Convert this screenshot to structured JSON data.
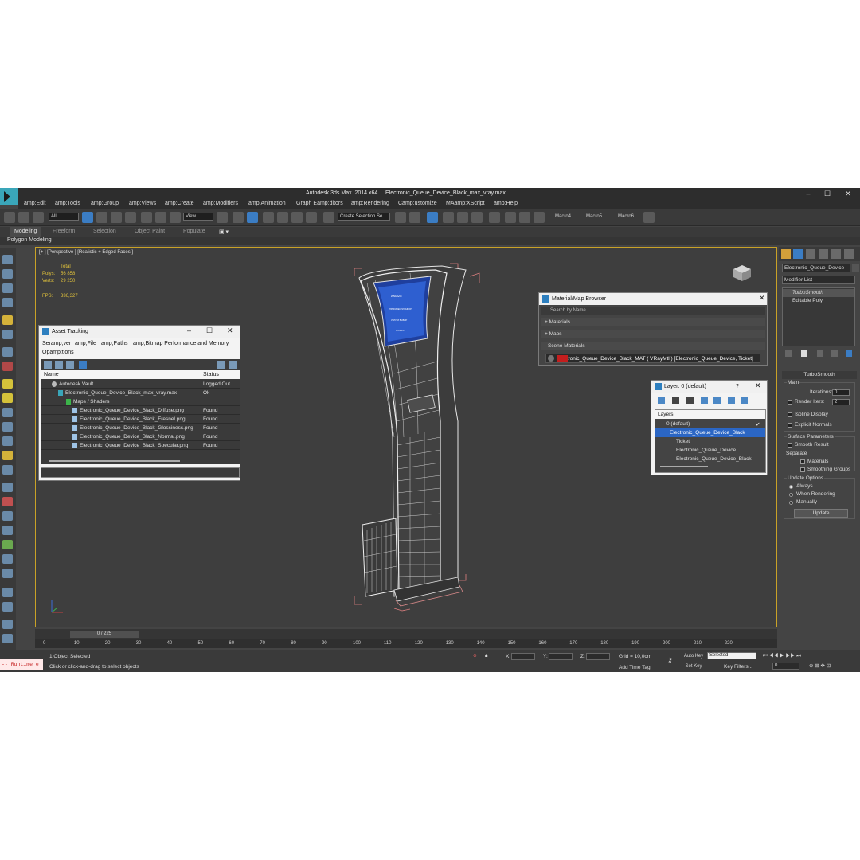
{
  "window": {
    "title": "Autodesk 3ds Max  2014 x64     Electronic_Queue_Device_Black_max_vray.max",
    "min": "–",
    "max": "☐",
    "close": "✕"
  },
  "menu": [
    "amp;Edit",
    "amp;Tools",
    "amp;Group",
    "amp;Views",
    "amp;Create",
    "amp;Modifiers",
    "amp;Animation",
    "Graph Eamp;ditors",
    "amp;Rendering",
    "Camp;ustomize",
    "MAamp;XScript",
    "amp;Help"
  ],
  "toolbar": {
    "filter_select": "All",
    "view_select": "View",
    "selection_set": "Create Selection Se",
    "macros": [
      "Macro4",
      "Macro5",
      "Macro6"
    ]
  },
  "ribbon": {
    "tabs": [
      "Modeling",
      "Freeform",
      "Selection",
      "Object Paint",
      "Populate"
    ],
    "sub": "Polygon Modeling"
  },
  "viewport": {
    "label": "[+ ] [Perspective ] [Realistic + Edged Faces ]",
    "stats": {
      "total_label": "Total",
      "polys_label": "Polys:",
      "polys": "56 858",
      "verts_label": "Verts:",
      "verts": "29 250",
      "fps_label": "FPS:",
      "fps": "336,327"
    },
    "screen": [
      "ANLIZE",
      "ПРОИЗВЕСТИ ВЫБОР",
      "УСЛУГИ ВЫБОР",
      "ОПЛАТА"
    ]
  },
  "asset_tracking": {
    "title": "Asset Tracking",
    "menu": [
      "Seramp;ver",
      "amp;File",
      "amp;Paths",
      "amp;Bitmap Performance and Memory"
    ],
    "menu2": "Opamp;tions",
    "col_name": "Name",
    "col_status": "Status",
    "rows": [
      {
        "name": "Autodesk Vault",
        "status": "Logged Out ..."
      },
      {
        "name": "Electronic_Queue_Device_Black_max_vray.max",
        "status": "Ok"
      },
      {
        "name": "Maps / Shaders",
        "status": ""
      },
      {
        "name": "Electronic_Queue_Device_Black_Diffuse.png",
        "status": "Found"
      },
      {
        "name": "Electronic_Queue_Device_Black_Fresnel.png",
        "status": "Found"
      },
      {
        "name": "Electronic_Queue_Device_Black_Glossiness.png",
        "status": "Found"
      },
      {
        "name": "Electronic_Queue_Device_Black_Normal.png",
        "status": "Found"
      },
      {
        "name": "Electronic_Queue_Device_Black_Specular.png",
        "status": "Found"
      }
    ]
  },
  "material_browser": {
    "title": "Material/Map Browser",
    "search_placeholder": "Search by Name ...",
    "sections": [
      "+ Materials",
      "+ Maps",
      "- Scene Materials"
    ],
    "item": "Electronic_Queue_Device_Black_MAT  ( VRayMtl )  [Electronic_Queue_Device, Ticket]",
    "swatch_color": "#c41e1e"
  },
  "layer_dialog": {
    "title": "Layer: 0 (default)",
    "help": "?",
    "header": "Layers",
    "rows": [
      "0 (default)",
      "Electronic_Queue_Device_Black",
      "Ticket",
      "Electronic_Queue_Device",
      "Electronic_Queue_Device_Black"
    ]
  },
  "command_panel": {
    "object_name": "Electronic_Queue_Device",
    "modifier_list": "Modifier List",
    "stack": [
      "TurboSmooth",
      "Editable Poly"
    ],
    "rollout": "TurboSmooth",
    "main_label": "Main",
    "iterations_label": "Iterations:",
    "iterations": "0",
    "render_iters_label": "Render Iters:",
    "render_iters": "2",
    "isoline": "Isoline Display",
    "explicit": "Explicit Normals",
    "surface_params": "Surface Parameters",
    "smooth_result": "Smooth Result",
    "separate": "Separate",
    "materials": "Materials",
    "smoothing_groups": "Smoothing Groups",
    "update_options": "Update Options",
    "always": "Always",
    "when_rendering": "When Rendering",
    "manually": "Manually",
    "update_btn": "Update"
  },
  "timeline": {
    "slider": "0 / 225",
    "ticks": [
      "0",
      "10",
      "20",
      "30",
      "40",
      "50",
      "60",
      "70",
      "80",
      "90",
      "100",
      "110",
      "120",
      "130",
      "140",
      "150",
      "160",
      "170",
      "180",
      "190",
      "200",
      "210",
      "220"
    ]
  },
  "status": {
    "maxscript": "-- Runtime e",
    "selected": "1 Object Selected",
    "prompt": "Click or click-and-drag to select objects",
    "x_label": "X:",
    "y_label": "Y:",
    "z_label": "Z:",
    "grid": "Grid = 10,0cm",
    "add_time_tag": "Add Time Tag",
    "auto_key": "Auto Key",
    "set_key": "Set Key",
    "selected_dropdown": "Selected",
    "key_filters": "Key Filters...",
    "frame": "0"
  }
}
